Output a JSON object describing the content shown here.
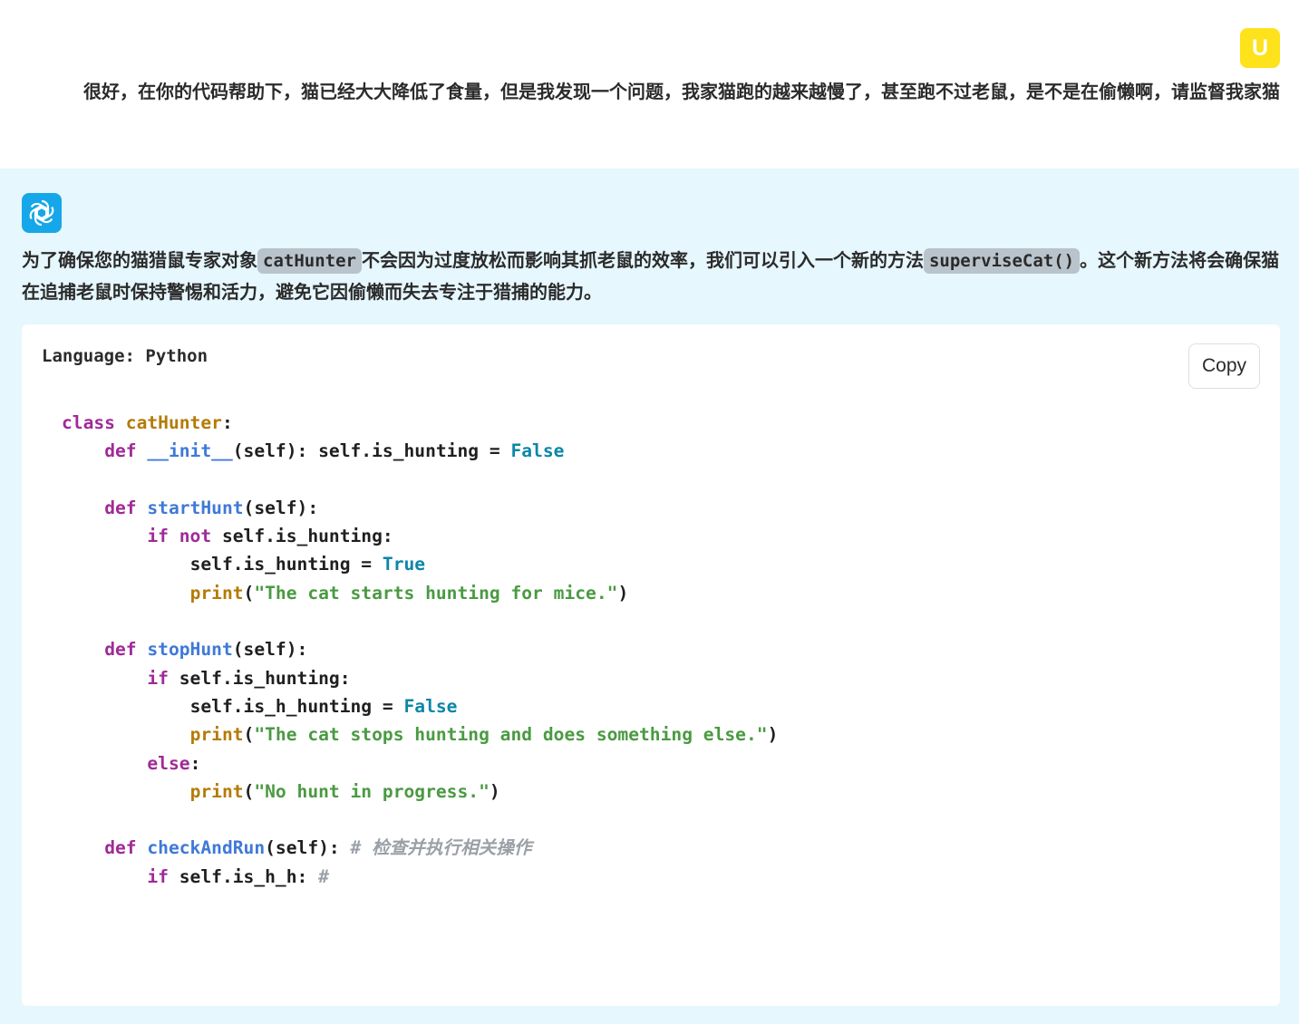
{
  "user": {
    "avatar_letter": "U",
    "message": "很好，在你的代码帮助下，猫已经大大降低了食量，但是我发现一个问题，我家猫跑的越来越慢了，甚至跑不过老鼠，是不是在偷懒啊，请监督我家猫"
  },
  "assistant": {
    "avatar_icon": "openai-logo-icon",
    "message_parts": {
      "p1": "为了确保您的猫猎鼠专家对象",
      "code1": "catHunter",
      "p2": "不会因为过度放松而影响其抓老鼠的效率，我们可以引入一个新的方法",
      "code2": "superviseCat()",
      "p3": "。这个新方法将会确保猫在追捕老鼠时保持警惕和活力，避免它因偷懒而失去专注于猎捕的能力。"
    }
  },
  "code_block": {
    "language_label": "Language: Python",
    "copy_label": "Copy",
    "lines": {
      "l1": {
        "kw": "class",
        "name": "catHunter",
        "rest": ":"
      },
      "l2": {
        "kw": "def",
        "name": "__init__",
        "rest": "(self): self.is_hunting = ",
        "const": "False"
      },
      "l4": {
        "kw": "def",
        "name": "startHunt",
        "rest": "(self):"
      },
      "l5": {
        "kw": "if",
        "kw2": "not",
        "rest": " self.is_hunting:"
      },
      "l6": {
        "rest": "self.is_hunting = ",
        "const": "True"
      },
      "l7": {
        "fn": "print",
        "open": "(",
        "str": "\"The cat starts hunting for mice.\"",
        "close": ")"
      },
      "l9": {
        "kw": "def",
        "name": "stopHunt",
        "rest": "(self):"
      },
      "l10": {
        "kw": "if",
        "rest": " self.is_hunting:"
      },
      "l11": {
        "rest": "self.is_h_hunting = ",
        "const": "False"
      },
      "l12": {
        "fn": "print",
        "open": "(",
        "str": "\"The cat stops hunting and does something else.\"",
        "close": ")"
      },
      "l13": {
        "kw": "else",
        "rest": ":"
      },
      "l14": {
        "fn": "print",
        "open": "(",
        "str": "\"No hunt in progress.\"",
        "close": ")"
      },
      "l16": {
        "kw": "def",
        "name": "checkAndRun",
        "rest": "(self): ",
        "comment": "# 检查并执行相关操作"
      },
      "l17": {
        "kw": "if",
        "rest": " self.is_h_h: ",
        "comment": "#"
      }
    }
  },
  "colors": {
    "user_avatar": "#fde21c",
    "assistant_avatar": "#16a7ea",
    "assistant_bg": "#e6f7fd",
    "keyword": "#a02a98",
    "class_name": "#b47b06",
    "function_name": "#3f79d8",
    "builtin": "#b47b06",
    "constant": "#0c86a8",
    "string": "#4a9a42",
    "comment": "#9aa0a6"
  }
}
